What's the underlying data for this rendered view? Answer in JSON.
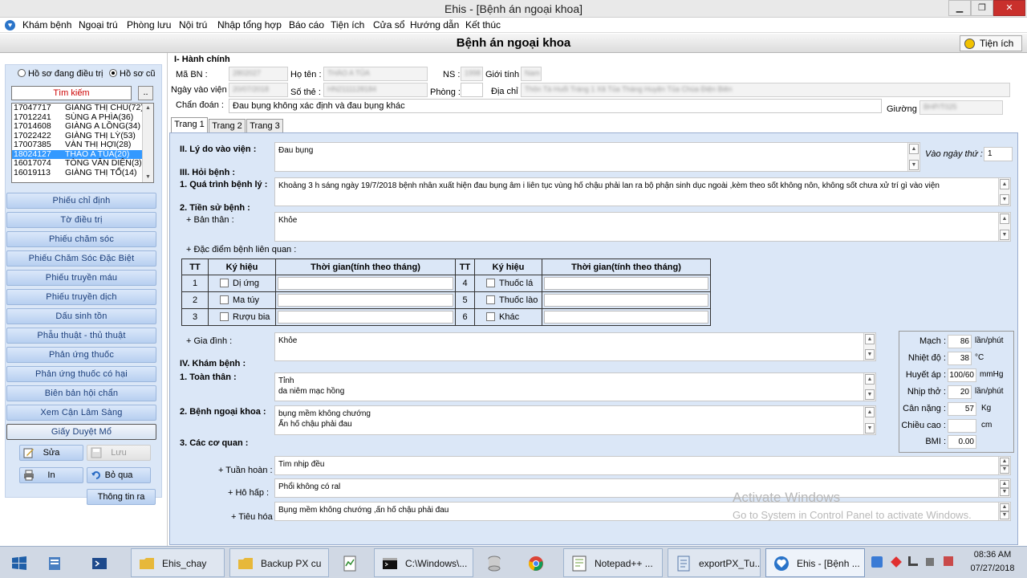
{
  "window": {
    "title": "Ehis - [Bệnh án ngoại khoa]",
    "min": "▁",
    "max": "❐",
    "close": "✕"
  },
  "menu": [
    "Khám bệnh",
    "Ngoại trú",
    "Phòng lưu",
    "Nội trú",
    "Nhập tổng hợp",
    "Báo cáo",
    "Tiện ích",
    "Cửa sổ",
    "Hướng dẫn",
    "Kết thúc"
  ],
  "form": {
    "title": "Bệnh án ngoại khoa",
    "tienich": "Tiện ích"
  },
  "left": {
    "radio1": "Hồ sơ đang điều trị",
    "radio2": "Hồ sơ cũ",
    "search_placeholder": "Tìm kiếm",
    "search_btn": "..",
    "patients": [
      {
        "id": "17047717",
        "name": "GIÀNG THỊ CHU(72)"
      },
      {
        "id": "17012241",
        "name": "SÙNG A PHÌA(36)"
      },
      {
        "id": "17014608",
        "name": "GIÀNG A LỒNG(34)"
      },
      {
        "id": "17022422",
        "name": "GIÀNG THỊ LỲ(53)"
      },
      {
        "id": "17007385",
        "name": "VÀN THỊ HỢI(28)"
      },
      {
        "id": "18024127",
        "name": "THÀO A TỦA(20)"
      },
      {
        "id": "16017074",
        "name": "TÒNG VĂN DIỆN(3)"
      },
      {
        "id": "16019113",
        "name": "GIÀNG THỊ TỔ(14)"
      }
    ],
    "nav": [
      "Phiếu chỉ định",
      "Tờ điều trị",
      "Phiếu chăm sóc",
      "Phiếu Chăm Sóc Đặc Biệt",
      "Phiếu truyền máu",
      "Phiếu truyền dịch",
      "Dấu sinh tồn",
      "Phẫu thuật - thủ thuật",
      "Phản ứng thuốc",
      "Phản ứng thuốc có hại",
      "Biên bản hội chẩn",
      "Xem Cận Lâm Sàng",
      "Giấy Duyệt Mổ"
    ],
    "actions": {
      "sua": "Sửa",
      "luu": "Lưu",
      "in": "In",
      "boqua": "Bỏ qua",
      "thongtinra": "Thông tin ra"
    }
  },
  "hanhchinh": {
    "heading": "I- Hành chính",
    "ma_bn": "Mã BN :",
    "ho_ten": "Họ tên :",
    "ns": "NS :",
    "gioi_tinh": "Giới tính :",
    "ngay_vao_vien": "Ngày vào viện",
    "so_the": "Số thẻ :",
    "phong": "Phòng :",
    "dia_chi": "Địa chỉ :",
    "chan_doan": "Chẩn đoán :",
    "chan_doan_value": "Đau bụng không xác định và đau bụng khác",
    "giuong": "Giường :"
  },
  "tabs": [
    "Trang 1",
    "Trang 2",
    "Trang 3"
  ],
  "page1": {
    "ly_do_label": "II. Lý do vào viện :",
    "ly_do_value": "Đau bụng",
    "vao_ngay_thu_label": "Vào ngày thứ :",
    "vao_ngay_thu_value": "1",
    "hoi_benh": "III. Hỏi bệnh :",
    "qua_trinh_label": "1. Quá trình bệnh lý :",
    "qua_trinh_value": "Khoảng 3 h sáng ngày 19/7/2018  bệnh nhân xuất hiện đau bụng âm i liên tục vùng hố chậu phải lan ra bộ phận sinh dục ngoài ,kèm theo sốt   không nôn, không sốt chưa xử trí gì vào viện",
    "tien_su_label": "2. Tiền sử bệnh :",
    "ban_than_label": "+ Bản thân :",
    "ban_than_value": "Khỏe",
    "dac_diem_label": "+ Đặc điểm bệnh liên quan :",
    "table_headers": {
      "tt": "TT",
      "ky_hieu": "Ký hiệu",
      "thoi_gian": "Thời gian(tính theo tháng)"
    },
    "table_rows": [
      {
        "tt": "1",
        "ky_hieu": "Dị ứng",
        "tt2": "4",
        "ky_hieu2": "Thuốc lá"
      },
      {
        "tt": "2",
        "ky_hieu": "Ma túy",
        "tt2": "5",
        "ky_hieu2": "Thuốc lào"
      },
      {
        "tt": "3",
        "ky_hieu": "Rượu bia",
        "tt2": "6",
        "ky_hieu2": "Khác"
      }
    ],
    "gia_dinh_label": "+ Gia đình :",
    "gia_dinh_value": "Khỏe",
    "kham_benh": "IV. Khám bệnh :",
    "toan_than_label": "1. Toàn thân :",
    "toan_than_line1": "Tỉnh",
    "toan_than_line2": "da niêm mạc hồng",
    "ngoai_khoa_label": "2. Bệnh ngoại khoa :",
    "ngoai_khoa_line1": "bụng mềm không chướng",
    "ngoai_khoa_line2": "Ấn hố chậu phải đau",
    "co_quan_label": "3. Các cơ quan :",
    "tuan_hoan_label": "+ Tuần hoàn :",
    "tuan_hoan_value": "Tim nhịp đều",
    "ho_hap_label": "+ Hô hấp :",
    "ho_hap_value": "Phổi không có ral",
    "tieu_hoa_label": "+ Tiêu hóa :",
    "tieu_hoa_value": "Bụng mềm không chướng ,ấn hố chậu phải đau"
  },
  "vitals": [
    {
      "label": "Mạch :",
      "value": "86",
      "unit": "lần/phút"
    },
    {
      "label": "Nhiệt độ :",
      "value": "38",
      "unit": "°C"
    },
    {
      "label": "Huyết áp :",
      "value": "100/60",
      "unit": "mmHg"
    },
    {
      "label": "Nhịp thở :",
      "value": "20",
      "unit": "lần/phút"
    },
    {
      "label": "Cân nặng :",
      "value": "57",
      "unit": "Kg"
    },
    {
      "label": "Chiều cao :",
      "value": "",
      "unit": "cm"
    },
    {
      "label": "BMI :",
      "value": "0.00",
      "unit": ""
    }
  ],
  "watermark": {
    "line1": "Activate Windows",
    "line2": "Go to System in Control Panel to activate Windows."
  },
  "taskbar": {
    "items": [
      "Ehis_chay",
      "Backup PX cu",
      "C:\\Windows\\...",
      "Notepad++ ...",
      "exportPX_Tu...",
      "Ehis - [Bệnh ..."
    ],
    "time": "08:36 AM",
    "date": "07/27/2018"
  }
}
